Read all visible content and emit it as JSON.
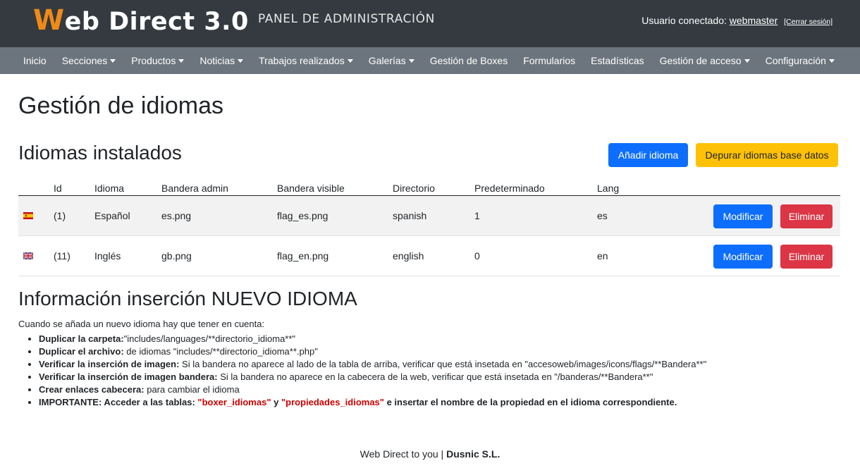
{
  "header": {
    "logo_w": "W",
    "logo_rest": "eb Direct 3.0",
    "panel_title": "PANEL DE ADMINISTRACIÓN",
    "user_label": "Usuario conectado:",
    "username": "webmaster",
    "logout": "[Cerrar sesión]"
  },
  "nav": {
    "items": [
      {
        "label": "Inicio",
        "dropdown": false
      },
      {
        "label": "Secciones",
        "dropdown": true
      },
      {
        "label": "Productos",
        "dropdown": true
      },
      {
        "label": "Noticias",
        "dropdown": true
      },
      {
        "label": "Trabajos realizados",
        "dropdown": true
      },
      {
        "label": "Galerías",
        "dropdown": true
      },
      {
        "label": "Gestión de Boxes",
        "dropdown": false
      },
      {
        "label": "Formularios",
        "dropdown": false
      },
      {
        "label": "Estadísticas",
        "dropdown": false
      },
      {
        "label": "Gestión de acceso",
        "dropdown": true
      },
      {
        "label": "Configuración",
        "dropdown": true
      }
    ]
  },
  "main": {
    "page_title": "Gestión de idiomas",
    "section_title": "Idiomas instalados",
    "add_button": "Añadir idioma",
    "purge_button": "Depurar idiomas base datos",
    "table": {
      "headers": {
        "id": "Id",
        "idioma": "Idioma",
        "bandera_admin": "Bandera admin",
        "bandera_visible": "Bandera visible",
        "directorio": "Directorio",
        "predeterminado": "Predeterminado",
        "lang": "Lang"
      },
      "rows": [
        {
          "flag": "es",
          "id": "(1)",
          "idioma": "Español",
          "bandera_admin": "es.png",
          "bandera_visible": "flag_es.png",
          "directorio": "spanish",
          "predeterminado": "1",
          "lang": "es",
          "modify": "Modificar",
          "delete": "Eliminar"
        },
        {
          "flag": "gb",
          "id": "(11)",
          "idioma": "Inglés",
          "bandera_admin": "gb.png",
          "bandera_visible": "flag_en.png",
          "directorio": "english",
          "predeterminado": "0",
          "lang": "en",
          "modify": "Modificar",
          "delete": "Eliminar"
        }
      ]
    }
  },
  "info": {
    "title": "Información inserción NUEVO IDIOMA",
    "intro": "Cuando se añada un nuevo idioma hay que tener en cuenta:",
    "items": [
      {
        "bold": "Duplicar la carpeta:",
        "text": "\"includes/languages/**directorio_idioma**\""
      },
      {
        "bold": "Duplicar el archivo:",
        "text": " de idiomas \"includes/**directorio_idioma**.php\""
      },
      {
        "bold": "Verificar la inserción de imagen:",
        "text": " Si la bandera no aparece al lado de la tabla de arriba, verificar que está insetada en \"accesoweb/images/icons/flags/**Bandera**\""
      },
      {
        "bold": "Verificar la inserción de imagen bandera:",
        "text": " Si la bandera no aparece en la cabecera de la web, verificar que está insetada en \"/banderas/**Bandera**\""
      },
      {
        "bold": "Crear enlaces cabecera:",
        "text": " para cambiar el idioma"
      }
    ],
    "important": {
      "prefix": "IMPORTANTE: Acceder a las tablas: ",
      "table1": "\"boxer_idiomas\"",
      "and": " y ",
      "table2": "\"propiedades_idiomas\"",
      "suffix": " e insertar el nombre de la propiedad en el idioma correspondiente."
    }
  },
  "footer": {
    "text": "Web Direct to you | ",
    "company": "Dusnic S.L."
  },
  "colors": {
    "topbar": "#343a40",
    "navbar": "#6c757d",
    "logo_accent": "#f08a16",
    "primary": "#0d6efd",
    "warning": "#ffc107",
    "danger": "#dc3545"
  }
}
